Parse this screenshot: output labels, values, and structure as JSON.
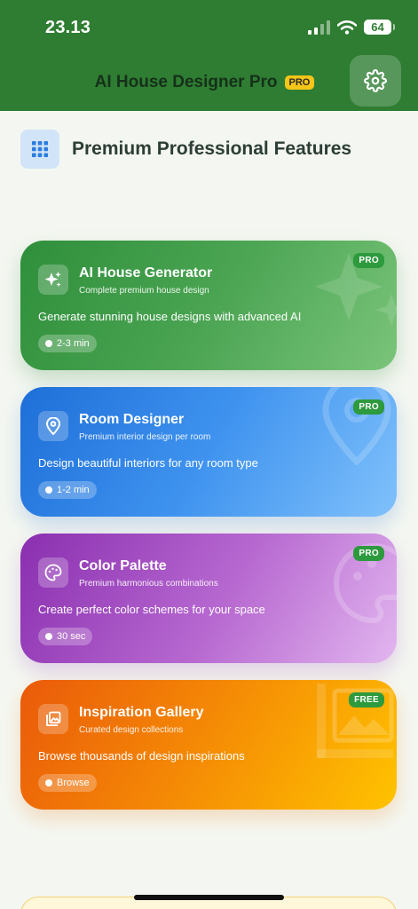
{
  "status": {
    "time": "23.13",
    "battery": "64"
  },
  "header": {
    "title": "AI House Designer Pro",
    "badge": "PRO"
  },
  "section": {
    "title": "Premium Professional Features"
  },
  "features": [
    {
      "title": "AI House Generator",
      "subtitle": "Complete premium house design",
      "description": "Generate stunning house designs with advanced AI",
      "chip": "2-3 min",
      "badge": "PRO"
    },
    {
      "title": "Room Designer",
      "subtitle": "Premium interior design per room",
      "description": "Design beautiful interiors for any room type",
      "chip": "1-2 min",
      "badge": "PRO"
    },
    {
      "title": "Color Palette",
      "subtitle": "Premium harmonious combinations",
      "description": "Create perfect color schemes for your space",
      "chip": "30 sec",
      "badge": "PRO"
    },
    {
      "title": "Inspiration Gallery",
      "subtitle": "Curated design collections",
      "description": "Browse thousands of design inspirations",
      "chip": "Browse",
      "badge": "FREE"
    }
  ],
  "colors": {
    "header": "#2e7d32",
    "pro_badge": "#f5c518",
    "tier_badge": "#2e9a3e"
  },
  "icons": [
    "gear-icon",
    "grid-icon",
    "sparkles-icon",
    "location-pin-icon",
    "palette-icon",
    "gallery-icon",
    "timer-icon"
  ]
}
